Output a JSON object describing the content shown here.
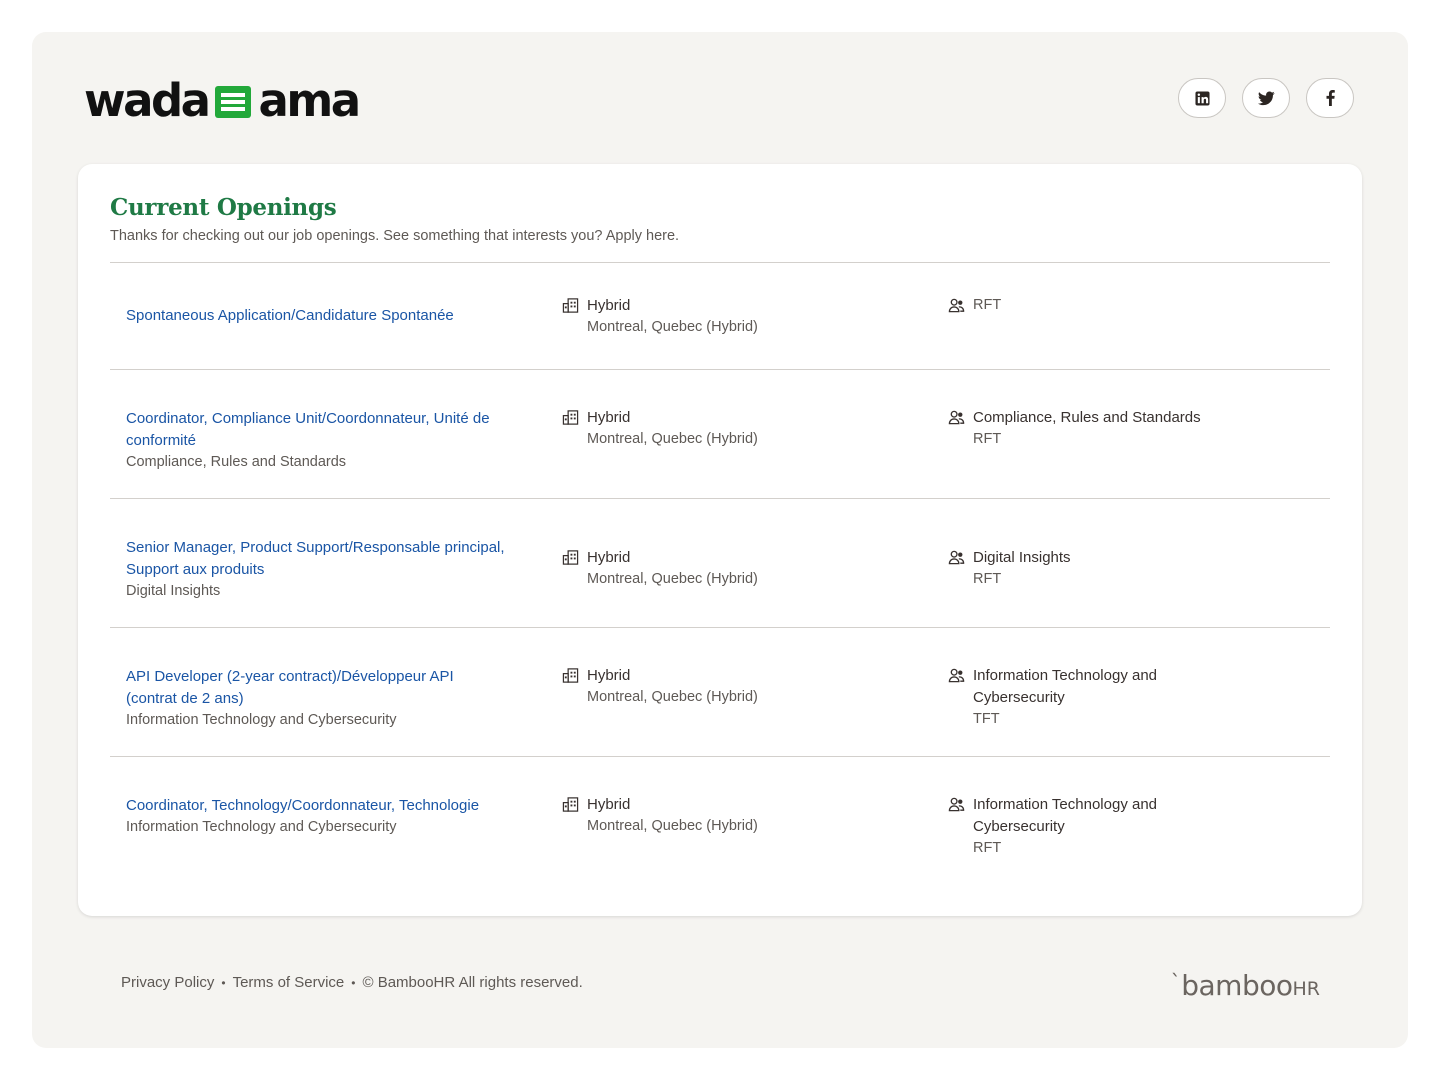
{
  "header": {
    "logo_left": "wada",
    "logo_right": "ama",
    "logo_accent": "#22a83a",
    "socials": [
      {
        "name": "linkedin",
        "icon": "linkedin-icon"
      },
      {
        "name": "twitter",
        "icon": "twitter-icon"
      },
      {
        "name": "facebook",
        "icon": "facebook-icon"
      }
    ]
  },
  "openings": {
    "title": "Current Openings",
    "subtitle": "Thanks for checking out our job openings. See something that interests you? Apply here.",
    "title_color": "#1f7a45",
    "link_color": "#1a55a5",
    "jobs": [
      {
        "title": "Spontaneous Application/Candidature Spontanée",
        "department": "",
        "location_type": "Hybrid",
        "location": "Montreal, Quebec (Hybrid)",
        "dept_primary": "",
        "employment": "RFT"
      },
      {
        "title": "Coordinator, Compliance Unit/Coordonnateur, Unité de conformité",
        "department": "Compliance, Rules and Standards",
        "location_type": "Hybrid",
        "location": "Montreal, Quebec (Hybrid)",
        "dept_primary": "Compliance, Rules and Standards",
        "employment": "RFT"
      },
      {
        "title": "Senior Manager, Product Support/Responsable principal, Support aux produits",
        "department": "Digital Insights",
        "location_type": "Hybrid",
        "location": "Montreal, Quebec (Hybrid)",
        "dept_primary": "Digital Insights",
        "employment": "RFT"
      },
      {
        "title": "API Developer (2-year contract)/Développeur API (contrat de 2 ans)",
        "department": "Information Technology and Cybersecurity",
        "location_type": "Hybrid",
        "location": "Montreal, Quebec (Hybrid)",
        "dept_primary": "Information Technology and Cybersecurity",
        "employment": "TFT"
      },
      {
        "title": "Coordinator, Technology/Coordonnateur, Technologie",
        "department": "Information Technology and Cybersecurity",
        "location_type": "Hybrid",
        "location": "Montreal, Quebec (Hybrid)",
        "dept_primary": "Information Technology and Cybersecurity",
        "employment": "RFT"
      }
    ]
  },
  "footer": {
    "privacy": "Privacy Policy",
    "terms": "Terms of Service",
    "copyright": "© BambooHR All rights reserved.",
    "brand_main": "bamboo",
    "brand_hr": "HR"
  }
}
